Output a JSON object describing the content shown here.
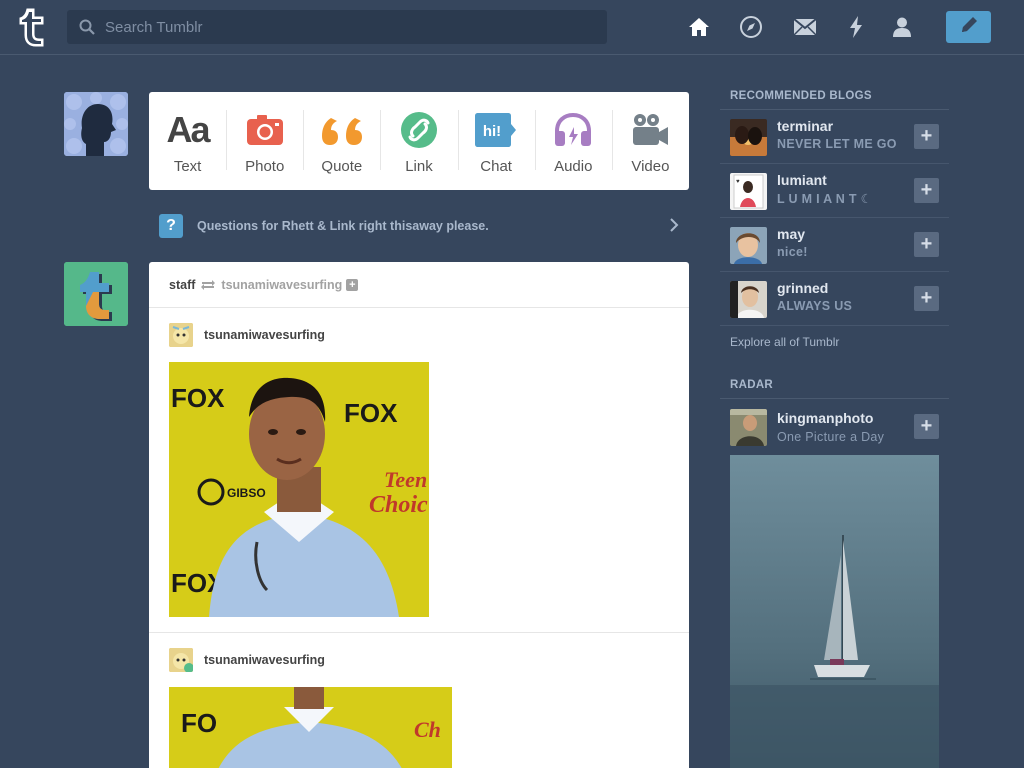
{
  "header": {
    "search_placeholder": "Search Tumblr",
    "nav": [
      "home-icon",
      "explore-icon",
      "inbox-icon",
      "activity-icon",
      "account-icon"
    ],
    "compose_icon": "pencil-icon",
    "accent": "#529ecc"
  },
  "post_types": [
    {
      "label": "Text",
      "icon": "text-icon",
      "color": "#444444"
    },
    {
      "label": "Photo",
      "icon": "camera-icon",
      "color": "#e8614e"
    },
    {
      "label": "Quote",
      "icon": "quote-icon",
      "color": "#f2992e"
    },
    {
      "label": "Link",
      "icon": "link-icon",
      "color": "#56bc8a"
    },
    {
      "label": "Chat",
      "icon": "chat-icon",
      "color": "#529ecc"
    },
    {
      "label": "Audio",
      "icon": "headphones-icon",
      "color": "#a77dc2"
    },
    {
      "label": "Video",
      "icon": "video-camera-icon",
      "color": "#748089"
    }
  ],
  "question": {
    "icon_text": "?",
    "text": "Questions for Rhett & Link right thisaway please."
  },
  "post": {
    "author": "staff",
    "reblogged_from": "tsunamiwavesurfing",
    "follow_glyph": "+",
    "trail": [
      {
        "name": "tsunamiwavesurfing"
      },
      {
        "name": "tsunamiwavesurfing"
      }
    ],
    "photo_text": "FOX"
  },
  "sidebar": {
    "recommended_title": "RECOMMENDED BLOGS",
    "blogs": [
      {
        "name": "terminar",
        "subtitle": "NEVER LET ME GO"
      },
      {
        "name": "lumiant",
        "subtitle": "L U M I A N T ☾"
      },
      {
        "name": "may",
        "subtitle": "nice!"
      },
      {
        "name": "grinned",
        "subtitle": "ALWAYS US"
      }
    ],
    "follow_glyph": "+",
    "explore_link": "Explore all of Tumblr",
    "radar_title": "RADAR",
    "radar": {
      "name": "kingmanphoto",
      "subtitle": "One Picture a Day"
    }
  }
}
